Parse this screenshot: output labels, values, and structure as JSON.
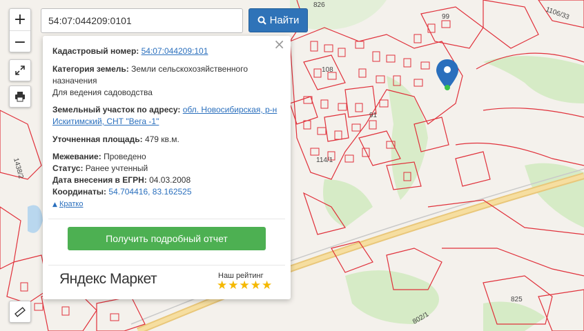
{
  "search": {
    "value": "54:07:044209:0101",
    "button_label": "Найти"
  },
  "controls": {
    "zoom_in": "+",
    "zoom_out": "−"
  },
  "info": {
    "cadastral_label": "Кадастровый номер:",
    "cadastral_value": "54:07:044209:101",
    "category_label": "Категория земель:",
    "category_value": "Земли сельскохозяйственного назначения",
    "usage_value": "Для ведения садоводства",
    "address_label": "Земельный участок по адресу:",
    "address_value": "обл. Новосибирская, р-н Искитимский, СНТ \"Вега -1\"",
    "area_label": "Уточненная площадь:",
    "area_value": "479 кв.м.",
    "survey_label": "Межевание:",
    "survey_value": "Проведено",
    "status_label": "Статус:",
    "status_value": "Ранее учтенный",
    "egrn_label": "Дата внесения в ЕГРН:",
    "egrn_value": "04.03.2008",
    "coords_label": "Координаты:",
    "coords_value": "54.704416, 83.162525",
    "collapse_label": "Кратко",
    "report_button": "Получить подробный отчет"
  },
  "ad": {
    "logo": "Яндекс Маркет",
    "rating_label": "Наш рейтинг",
    "stars": "★★★★★"
  },
  "map_labels": {
    "l826": "826",
    "l99": "99",
    "l1106": "1106/33",
    "l108": "108",
    "l91": "91",
    "l114": "114/1",
    "l1438": "1438/2",
    "l825": "825",
    "l802": "802/1"
  },
  "colors": {
    "parcel_line": "#e0303a",
    "green_zone": "#d6ebc6",
    "road": "#f3d58c",
    "accent": "#2f73b8",
    "report": "#4db052"
  }
}
